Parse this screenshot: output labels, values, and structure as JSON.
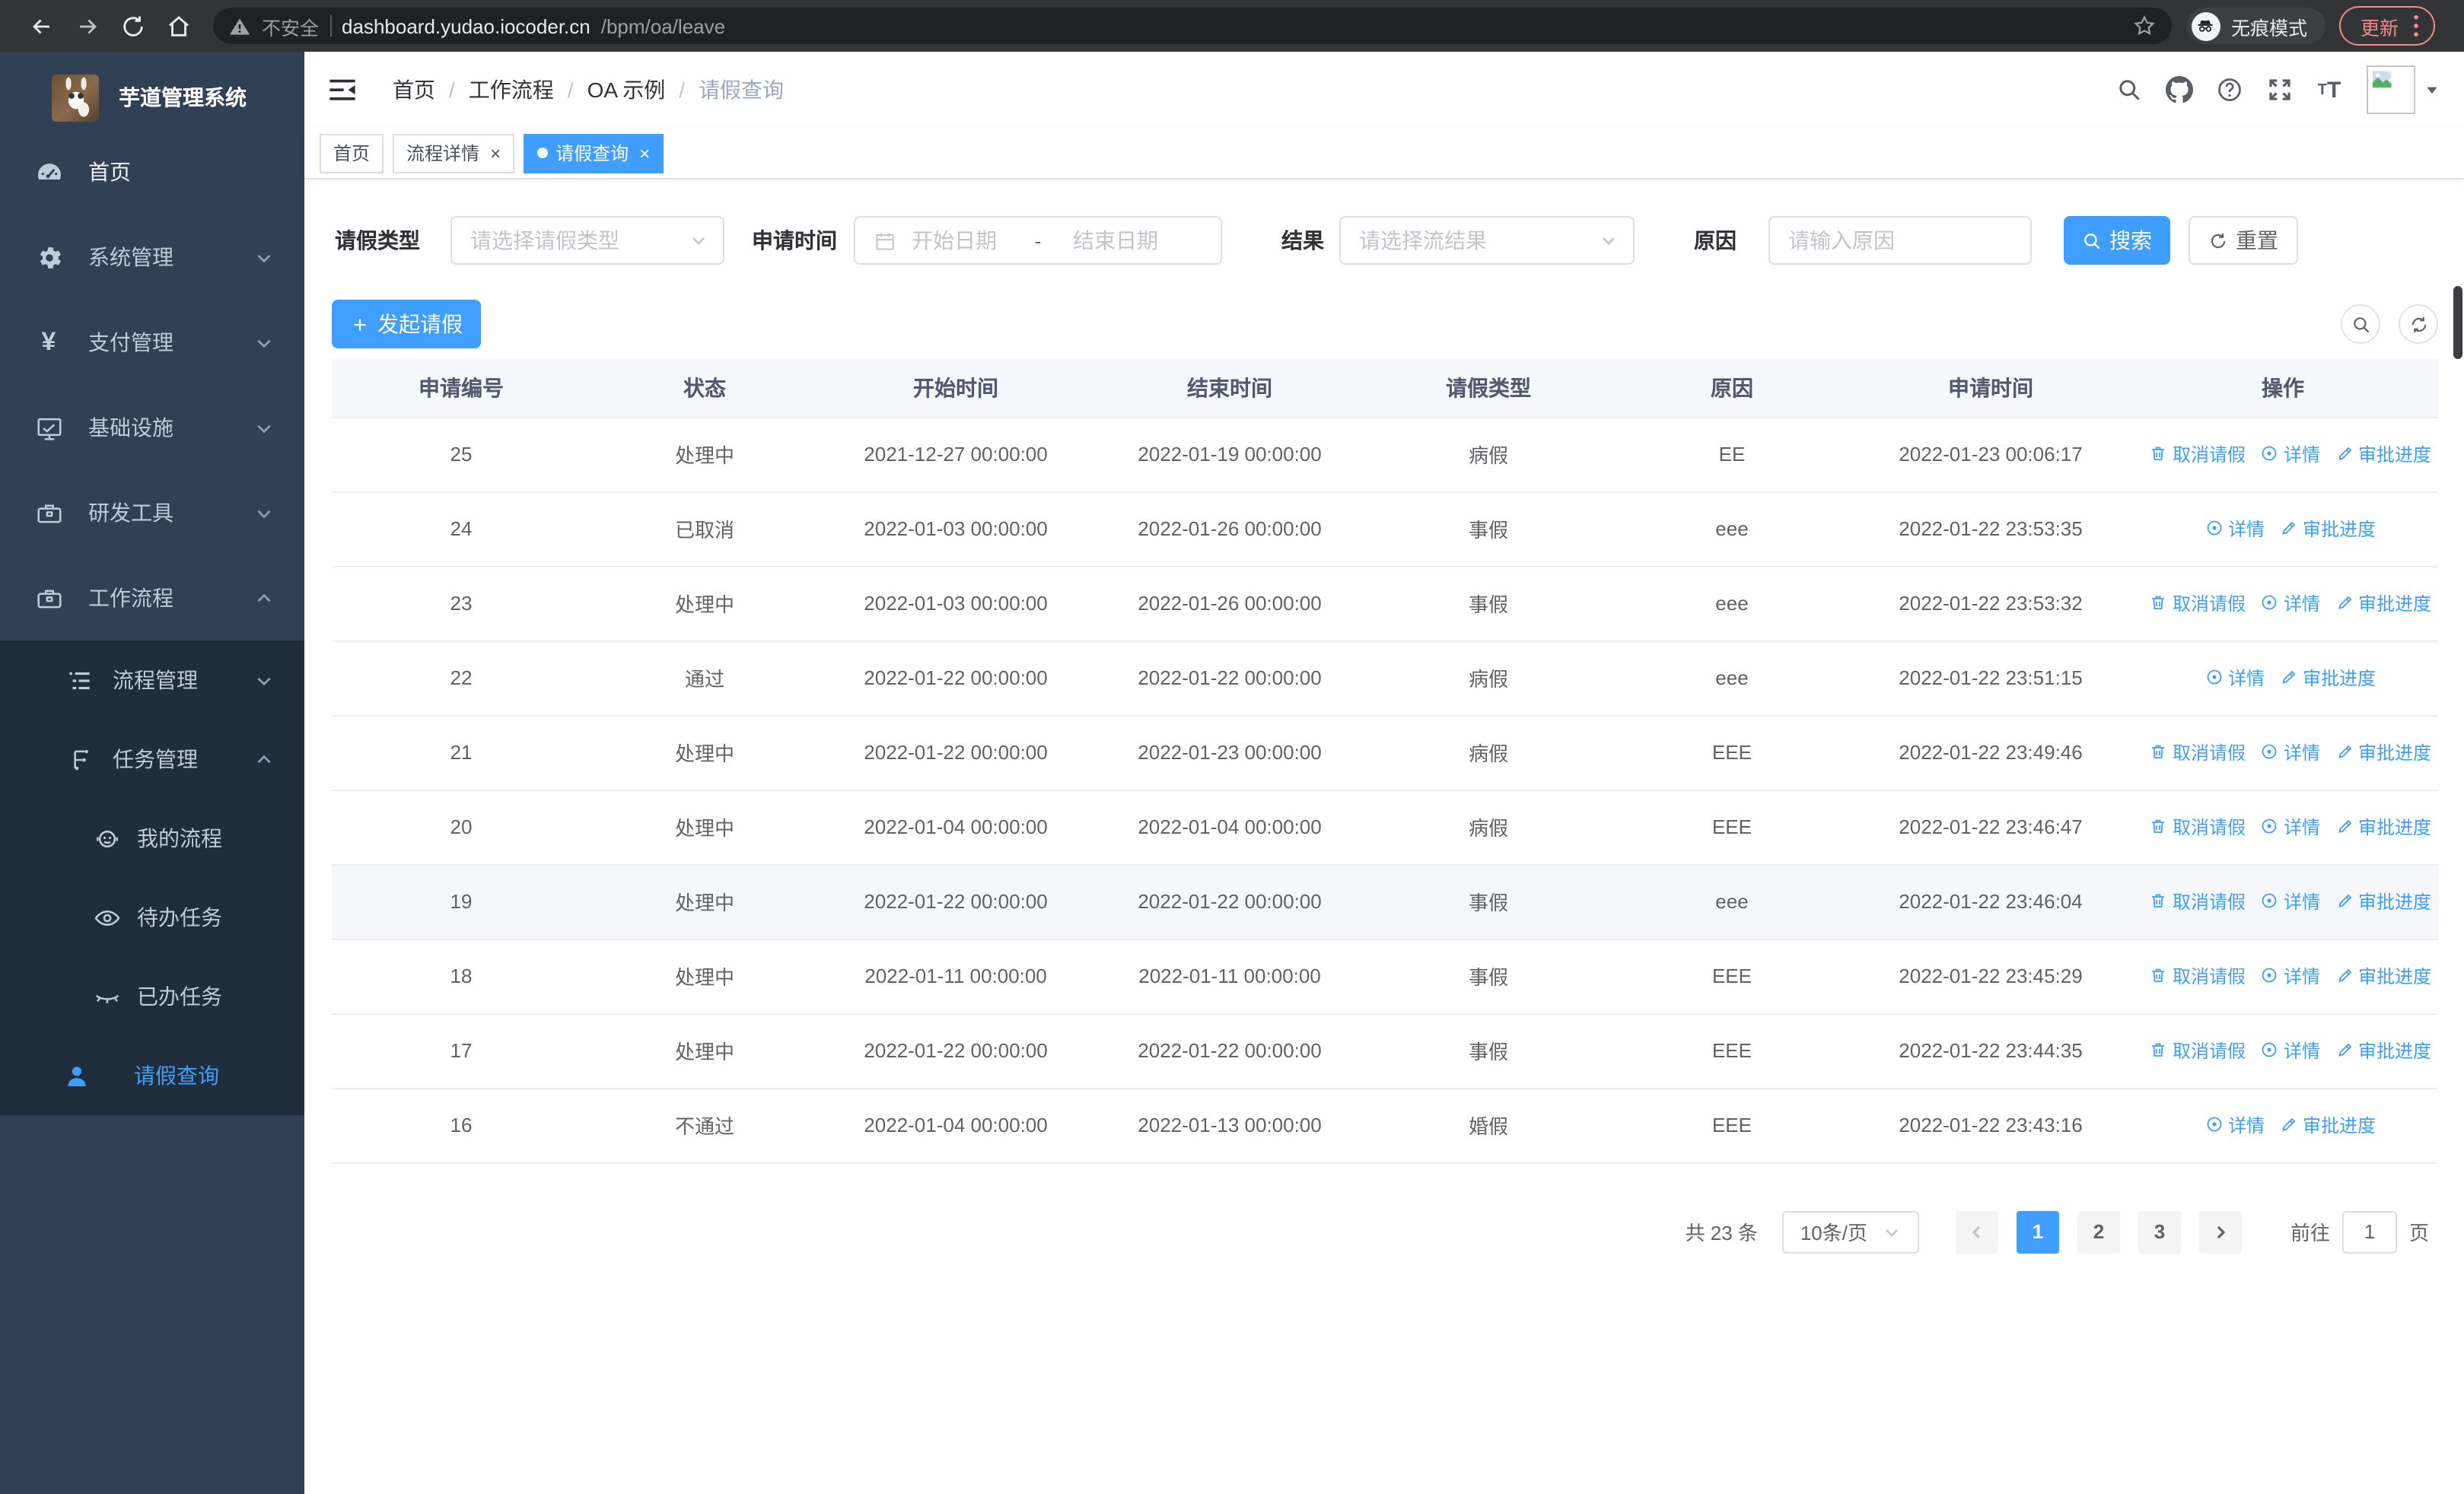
{
  "browser": {
    "security_warning": "不安全",
    "url_host": "dashboard.yudao.iocoder.cn",
    "url_path": "/bpm/oa/leave",
    "incognito_label": "无痕模式",
    "update_label": "更新"
  },
  "sidebar": {
    "title": "芋道管理系统",
    "items": [
      {
        "label": "首页"
      },
      {
        "label": "系统管理"
      },
      {
        "label": "支付管理"
      },
      {
        "label": "基础设施"
      },
      {
        "label": "研发工具"
      },
      {
        "label": "工作流程"
      },
      {
        "label": "流程管理"
      },
      {
        "label": "任务管理"
      },
      {
        "label": "我的流程"
      },
      {
        "label": "待办任务"
      },
      {
        "label": "已办任务"
      },
      {
        "label": "请假查询"
      }
    ]
  },
  "breadcrumb": {
    "separator": "/",
    "items": [
      "首页",
      "工作流程",
      "OA 示例",
      "请假查询"
    ]
  },
  "tabs": [
    {
      "label": "首页"
    },
    {
      "label": "流程详情"
    },
    {
      "label": "请假查询"
    }
  ],
  "filters": {
    "leave_type_label": "请假类型",
    "leave_type_placeholder": "请选择请假类型",
    "apply_time_label": "申请时间",
    "start_date_placeholder": "开始日期",
    "date_separator": "-",
    "end_date_placeholder": "结束日期",
    "result_label": "结果",
    "result_placeholder": "请选择流结果",
    "reason_label": "原因",
    "reason_placeholder": "请输入原因",
    "search_label": "搜索",
    "reset_label": "重置"
  },
  "toolbar": {
    "create_label": "发起请假"
  },
  "table": {
    "columns": [
      "申请编号",
      "状态",
      "开始时间",
      "结束时间",
      "请假类型",
      "原因",
      "申请时间",
      "操作"
    ],
    "action_labels": {
      "cancel": "取消请假",
      "detail": "详情",
      "progress": "审批进度"
    },
    "rows": [
      {
        "id": "25",
        "status": "处理中",
        "start": "2021-12-27 00:00:00",
        "end": "2022-01-19 00:00:00",
        "type": "病假",
        "reason": "EE",
        "applyTime": "2022-01-23 00:06:17",
        "actions": [
          "cancel",
          "detail",
          "progress"
        ],
        "highlight": false
      },
      {
        "id": "24",
        "status": "已取消",
        "start": "2022-01-03 00:00:00",
        "end": "2022-01-26 00:00:00",
        "type": "事假",
        "reason": "eee",
        "applyTime": "2022-01-22 23:53:35",
        "actions": [
          "detail",
          "progress"
        ],
        "highlight": false
      },
      {
        "id": "23",
        "status": "处理中",
        "start": "2022-01-03 00:00:00",
        "end": "2022-01-26 00:00:00",
        "type": "事假",
        "reason": "eee",
        "applyTime": "2022-01-22 23:53:32",
        "actions": [
          "cancel",
          "detail",
          "progress"
        ],
        "highlight": false
      },
      {
        "id": "22",
        "status": "通过",
        "start": "2022-01-22 00:00:00",
        "end": "2022-01-22 00:00:00",
        "type": "病假",
        "reason": "eee",
        "applyTime": "2022-01-22 23:51:15",
        "actions": [
          "detail",
          "progress"
        ],
        "highlight": false
      },
      {
        "id": "21",
        "status": "处理中",
        "start": "2022-01-22 00:00:00",
        "end": "2022-01-23 00:00:00",
        "type": "病假",
        "reason": "EEE",
        "applyTime": "2022-01-22 23:49:46",
        "actions": [
          "cancel",
          "detail",
          "progress"
        ],
        "highlight": false
      },
      {
        "id": "20",
        "status": "处理中",
        "start": "2022-01-04 00:00:00",
        "end": "2022-01-04 00:00:00",
        "type": "病假",
        "reason": "EEE",
        "applyTime": "2022-01-22 23:46:47",
        "actions": [
          "cancel",
          "detail",
          "progress"
        ],
        "highlight": false
      },
      {
        "id": "19",
        "status": "处理中",
        "start": "2022-01-22 00:00:00",
        "end": "2022-01-22 00:00:00",
        "type": "事假",
        "reason": "eee",
        "applyTime": "2022-01-22 23:46:04",
        "actions": [
          "cancel",
          "detail",
          "progress"
        ],
        "highlight": true
      },
      {
        "id": "18",
        "status": "处理中",
        "start": "2022-01-11 00:00:00",
        "end": "2022-01-11 00:00:00",
        "type": "事假",
        "reason": "EEE",
        "applyTime": "2022-01-22 23:45:29",
        "actions": [
          "cancel",
          "detail",
          "progress"
        ],
        "highlight": false
      },
      {
        "id": "17",
        "status": "处理中",
        "start": "2022-01-22 00:00:00",
        "end": "2022-01-22 00:00:00",
        "type": "事假",
        "reason": "EEE",
        "applyTime": "2022-01-22 23:44:35",
        "actions": [
          "cancel",
          "detail",
          "progress"
        ],
        "highlight": false
      },
      {
        "id": "16",
        "status": "不通过",
        "start": "2022-01-04 00:00:00",
        "end": "2022-01-13 00:00:00",
        "type": "婚假",
        "reason": "EEE",
        "applyTime": "2022-01-22 23:43:16",
        "actions": [
          "detail",
          "progress"
        ],
        "highlight": false
      }
    ]
  },
  "pagination": {
    "total_label": "共 23 条",
    "page_size": "10条/页",
    "pages": [
      "1",
      "2",
      "3"
    ],
    "active_page": "1",
    "goto_label": "前往",
    "goto_value": "1",
    "goto_suffix": "页"
  },
  "colors": {
    "primary": "#409eff",
    "sidebar_bg": "#304156",
    "submenu_bg": "#1f2d3d"
  }
}
